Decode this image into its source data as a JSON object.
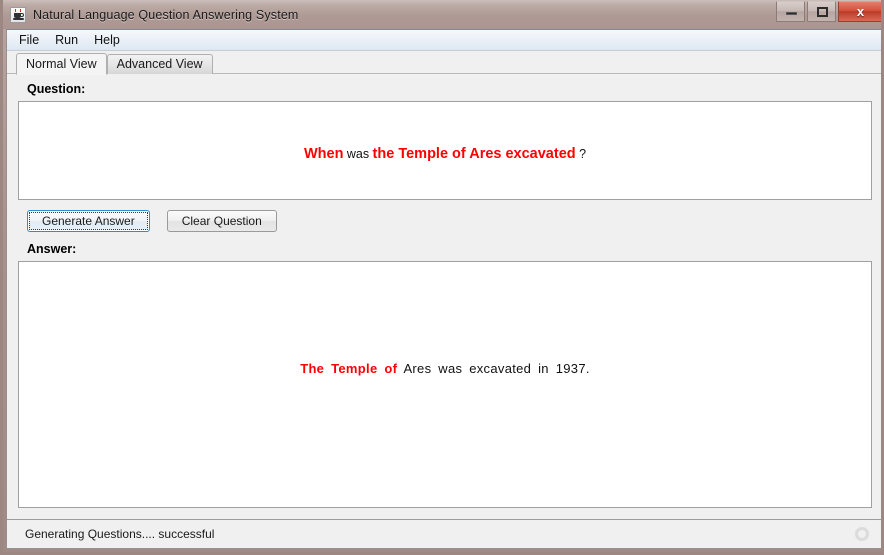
{
  "window": {
    "title": "Natural Language Question Answering System",
    "icon": "java-coffee-cup-icon",
    "buttons": {
      "minimize": "minimize-icon",
      "maximize": "maximize-icon",
      "close": "x"
    }
  },
  "menubar": {
    "items": [
      {
        "label": "File"
      },
      {
        "label": "Run"
      },
      {
        "label": "Help"
      }
    ]
  },
  "tabs": [
    {
      "label": "Normal View",
      "active": true
    },
    {
      "label": "Advanced View",
      "active": false
    }
  ],
  "question_section": {
    "label": "Question:",
    "tokens": [
      {
        "text": "When",
        "style": "red"
      },
      {
        "text": " was ",
        "style": "plain"
      },
      {
        "text": "the Temple of Ares excavated",
        "style": "red"
      },
      {
        "text": " ?",
        "style": "plain"
      }
    ],
    "full_text": "When was the Temple of Ares excavated ?"
  },
  "buttons": {
    "generate_answer": "Generate Answer",
    "clear_question": "Clear Question"
  },
  "answer_section": {
    "label": "Answer:",
    "tokens": [
      {
        "text": "The  Temple  of",
        "style": "red"
      },
      {
        "text": "  Ares  was  excavated  in  1937.",
        "style": "plain"
      }
    ],
    "full_text": "The Temple of Ares was excavated in 1937."
  },
  "statusbar": {
    "message": "Generating Questions.... successful",
    "busy_indicator": "circular-progress-icon"
  },
  "colors": {
    "highlight_red": "#ff0000",
    "titlebar": "#ab9590",
    "close_button": "#d4503a",
    "focus_border": "#2a8ed6",
    "panel_background": "#f0f0f0"
  }
}
